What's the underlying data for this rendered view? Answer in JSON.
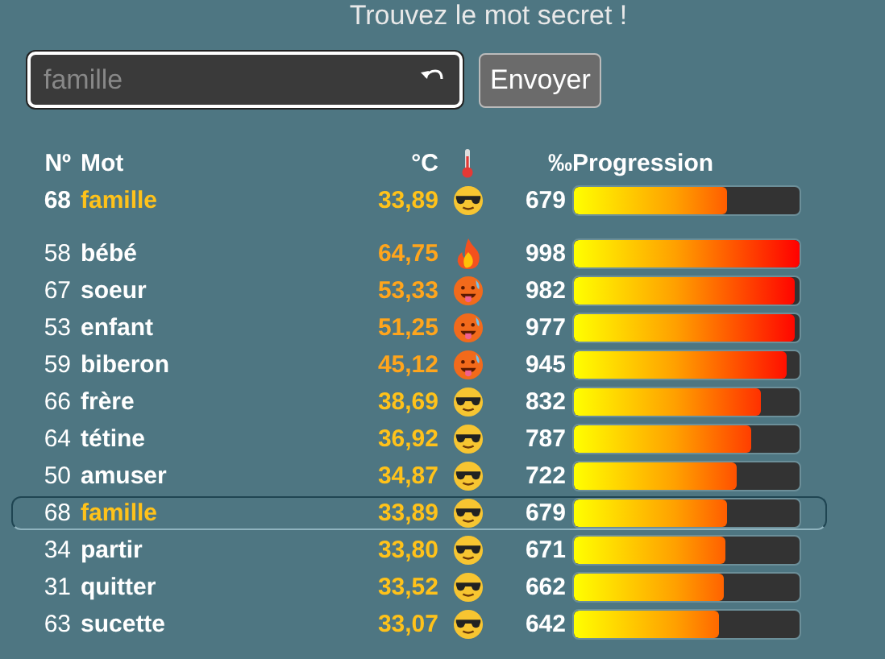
{
  "title": "Trouvez le mot secret !",
  "search": {
    "placeholder": "famille"
  },
  "submit": "Envoyer",
  "columns": {
    "number": "Nº",
    "word": "Mot",
    "temperature": "°C",
    "permille": "‰",
    "progress": "Progression"
  },
  "last_guess": {
    "number": "68",
    "word": "famille",
    "temperature": "33,89",
    "kind": "cool",
    "permille": "679",
    "level": 0.679
  },
  "rows": [
    {
      "number": "58",
      "word": "bébé",
      "temperature": "64,75",
      "kind": "fire",
      "permille": "998",
      "level": 0.998,
      "selected": false
    },
    {
      "number": "67",
      "word": "soeur",
      "temperature": "53,33",
      "kind": "hot",
      "permille": "982",
      "level": 0.982,
      "selected": false
    },
    {
      "number": "53",
      "word": "enfant",
      "temperature": "51,25",
      "kind": "hot",
      "permille": "977",
      "level": 0.977,
      "selected": false
    },
    {
      "number": "59",
      "word": "biberon",
      "temperature": "45,12",
      "kind": "hot",
      "permille": "945",
      "level": 0.945,
      "selected": false
    },
    {
      "number": "66",
      "word": "frère",
      "temperature": "38,69",
      "kind": "cool",
      "permille": "832",
      "level": 0.832,
      "selected": false
    },
    {
      "number": "64",
      "word": "tétine",
      "temperature": "36,92",
      "kind": "cool",
      "permille": "787",
      "level": 0.787,
      "selected": false
    },
    {
      "number": "50",
      "word": "amuser",
      "temperature": "34,87",
      "kind": "cool",
      "permille": "722",
      "level": 0.722,
      "selected": false
    },
    {
      "number": "68",
      "word": "famille",
      "temperature": "33,89",
      "kind": "cool",
      "permille": "679",
      "level": 0.679,
      "selected": true
    },
    {
      "number": "34",
      "word": "partir",
      "temperature": "33,80",
      "kind": "cool",
      "permille": "671",
      "level": 0.671,
      "selected": false
    },
    {
      "number": "31",
      "word": "quitter",
      "temperature": "33,52",
      "kind": "cool",
      "permille": "662",
      "level": 0.662,
      "selected": false
    },
    {
      "number": "63",
      "word": "sucette",
      "temperature": "33,07",
      "kind": "cool",
      "permille": "642",
      "level": 0.642,
      "selected": false
    }
  ]
}
